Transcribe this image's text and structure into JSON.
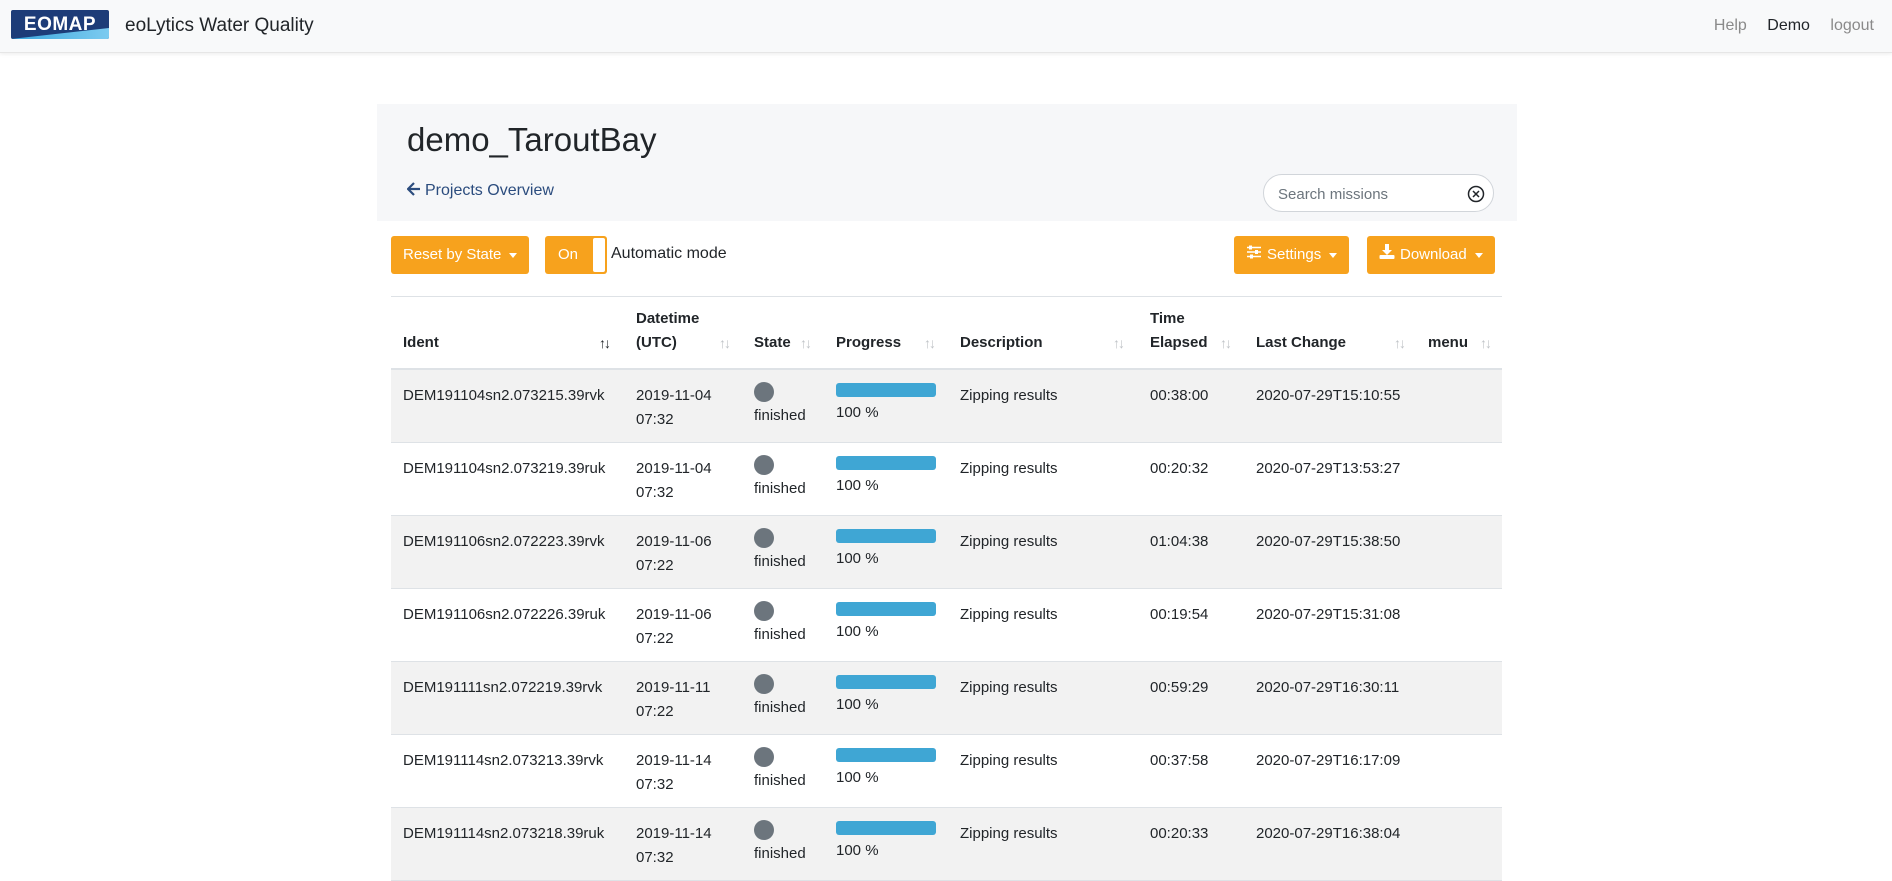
{
  "navbar": {
    "logo_text": "EOMAP",
    "app_title": "eoLytics Water Quality",
    "links": [
      "Help",
      "Demo",
      "logout"
    ]
  },
  "header": {
    "project_title": "demo_TaroutBay",
    "back_link": "Projects Overview",
    "search_placeholder": "Search missions"
  },
  "toolbar": {
    "reset_label": "Reset by State",
    "toggle_label": "On",
    "auto_mode_label": "Automatic mode",
    "settings_label": "Settings",
    "download_label": "Download"
  },
  "colors": {
    "accent": "#f7a21d",
    "progress": "#3fa6d4",
    "state_finished": "#6c757d",
    "brand": "#1d3c78"
  },
  "table": {
    "headers": {
      "ident": "Ident",
      "datetime_1": "Datetime",
      "datetime_2": "(UTC)",
      "state": "State",
      "progress": "Progress",
      "description": "Description",
      "time_1": "Time",
      "time_2": "Elapsed",
      "last_change": "Last Change",
      "menu": "menu"
    },
    "rows": [
      {
        "ident": "DEM191104sn2.073215.39rvk",
        "date": "2019-11-04",
        "time": "07:32",
        "state": "finished",
        "progress": 1.0,
        "progress_label": "100 %",
        "description": "Zipping results",
        "elapsed": "00:38:00",
        "last_change": "2020-07-29T15:10:55"
      },
      {
        "ident": "DEM191104sn2.073219.39ruk",
        "date": "2019-11-04",
        "time": "07:32",
        "state": "finished",
        "progress": 1.0,
        "progress_label": "100 %",
        "description": "Zipping results",
        "elapsed": "00:20:32",
        "last_change": "2020-07-29T13:53:27"
      },
      {
        "ident": "DEM191106sn2.072223.39rvk",
        "date": "2019-11-06",
        "time": "07:22",
        "state": "finished",
        "progress": 1.0,
        "progress_label": "100 %",
        "description": "Zipping results",
        "elapsed": "01:04:38",
        "last_change": "2020-07-29T15:38:50"
      },
      {
        "ident": "DEM191106sn2.072226.39ruk",
        "date": "2019-11-06",
        "time": "07:22",
        "state": "finished",
        "progress": 1.0,
        "progress_label": "100 %",
        "description": "Zipping results",
        "elapsed": "00:19:54",
        "last_change": "2020-07-29T15:31:08"
      },
      {
        "ident": "DEM191111sn2.072219.39rvk",
        "date": "2019-11-11",
        "time": "07:22",
        "state": "finished",
        "progress": 1.0,
        "progress_label": "100 %",
        "description": "Zipping results",
        "elapsed": "00:59:29",
        "last_change": "2020-07-29T16:30:11"
      },
      {
        "ident": "DEM191114sn2.073213.39rvk",
        "date": "2019-11-14",
        "time": "07:32",
        "state": "finished",
        "progress": 1.0,
        "progress_label": "100 %",
        "description": "Zipping results",
        "elapsed": "00:37:58",
        "last_change": "2020-07-29T16:17:09"
      },
      {
        "ident": "DEM191114sn2.073218.39ruk",
        "date": "2019-11-14",
        "time": "07:32",
        "state": "finished",
        "progress": 1.0,
        "progress_label": "100 %",
        "description": "Zipping results",
        "elapsed": "00:20:33",
        "last_change": "2020-07-29T16:38:04"
      }
    ]
  }
}
